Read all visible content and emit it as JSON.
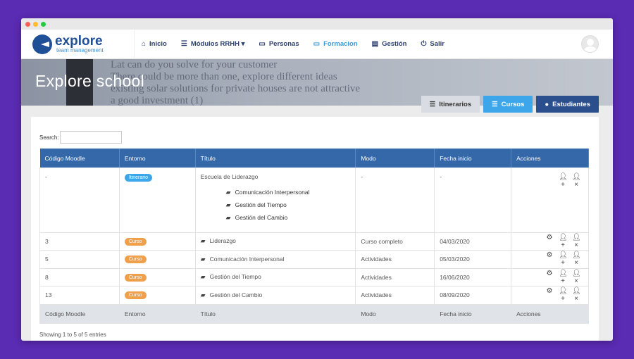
{
  "brand": {
    "name": "explore",
    "sub": "team management"
  },
  "nav": [
    {
      "label": "Inicio",
      "icon": "home-icon",
      "glyph": "⌂",
      "active": false
    },
    {
      "label": "Módulos RRHH ▾",
      "icon": "list-icon",
      "glyph": "☰",
      "active": false
    },
    {
      "label": "Personas",
      "icon": "calendar-icon",
      "glyph": "▭",
      "active": false
    },
    {
      "label": "Formacion",
      "icon": "calendar-icon",
      "glyph": "▭",
      "active": true
    },
    {
      "label": "Gestión",
      "icon": "id-card-icon",
      "glyph": "▤",
      "active": false
    },
    {
      "label": "Salir",
      "icon": "power-icon",
      "glyph": "⏻",
      "active": false
    }
  ],
  "banner": {
    "title": "Explore school",
    "bg_lines": [
      "Lat can do you solve for your customer",
      "There could be more than one, explore different ideas",
      "existing solar solutions for private houses are not attractive",
      "a good investment (1)"
    ]
  },
  "view_tabs": {
    "itinerarios": "Itinerarios",
    "cursos": "Cursos",
    "estudiantes": "Estudiantes"
  },
  "search": {
    "label": "Search:",
    "value": ""
  },
  "table": {
    "headers": [
      "Código Moodle",
      "Entorno",
      "Título",
      "Modo",
      "Fecha inicio",
      "Acciones"
    ],
    "first_row": {
      "codigo": "-",
      "entorno": "Itinerario",
      "titulo": "Escuela de Liderazgo",
      "modo": "-",
      "fecha": "-",
      "subitems": [
        "Comunicación Interpersonal",
        "Gestión del Tiempo",
        "Gestión del Cambio"
      ]
    },
    "rows": [
      {
        "codigo": "3",
        "entorno": "Curso",
        "titulo": "Liderazgo",
        "modo": "Curso completo",
        "fecha": "04/03/2020"
      },
      {
        "codigo": "5",
        "entorno": "Curso",
        "titulo": "Comunicación Interpersonal",
        "modo": "Actividades",
        "fecha": "05/03/2020"
      },
      {
        "codigo": "8",
        "entorno": "Curso",
        "titulo": "Gestión del Tiempo",
        "modo": "Actividades",
        "fecha": "16/06/2020"
      },
      {
        "codigo": "13",
        "entorno": "Curso",
        "titulo": "Gestión del Cambio",
        "modo": "Actividades",
        "fecha": "08/09/2020"
      }
    ]
  },
  "info": "Showing 1 to 5 of 5 entries",
  "colors": {
    "header_blue": "#3468a9",
    "accent": "#3da6ea",
    "badge_orange": "#f0a04b",
    "dark_blue": "#2b4f8c",
    "bg_purple": "#5a2bb3"
  }
}
